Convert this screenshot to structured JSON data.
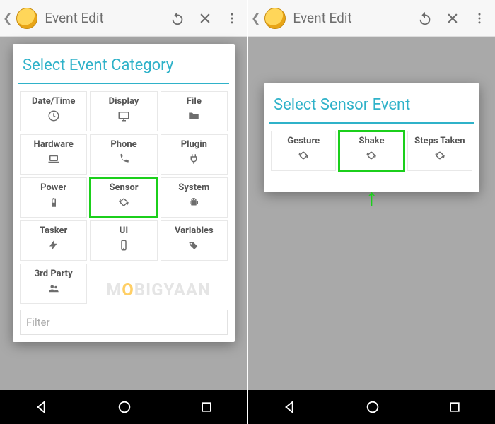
{
  "appbar": {
    "title": "Event Edit"
  },
  "left": {
    "dialog_title": "Select Event Category",
    "filter_placeholder": "Filter",
    "items": [
      {
        "label": "Date/Time",
        "icon": "clock"
      },
      {
        "label": "Display",
        "icon": "monitor"
      },
      {
        "label": "File",
        "icon": "folder"
      },
      {
        "label": "Hardware",
        "icon": "laptop"
      },
      {
        "label": "Phone",
        "icon": "phone"
      },
      {
        "label": "Plugin",
        "icon": "plug"
      },
      {
        "label": "Power",
        "icon": "battery"
      },
      {
        "label": "Sensor",
        "icon": "rotation",
        "highlight": true
      },
      {
        "label": "System",
        "icon": "android"
      },
      {
        "label": "Tasker",
        "icon": "bolt"
      },
      {
        "label": "UI",
        "icon": "phone-outline"
      },
      {
        "label": "Variables",
        "icon": "tags"
      },
      {
        "label": "3rd Party",
        "icon": "people"
      }
    ]
  },
  "right": {
    "dialog_title": "Select Sensor Event",
    "items": [
      {
        "label": "Gesture",
        "icon": "rotation"
      },
      {
        "label": "Shake",
        "icon": "rotation",
        "highlight": true
      },
      {
        "label": "Steps Taken",
        "icon": "rotation"
      }
    ]
  },
  "watermark": "MOBIGYAAN"
}
